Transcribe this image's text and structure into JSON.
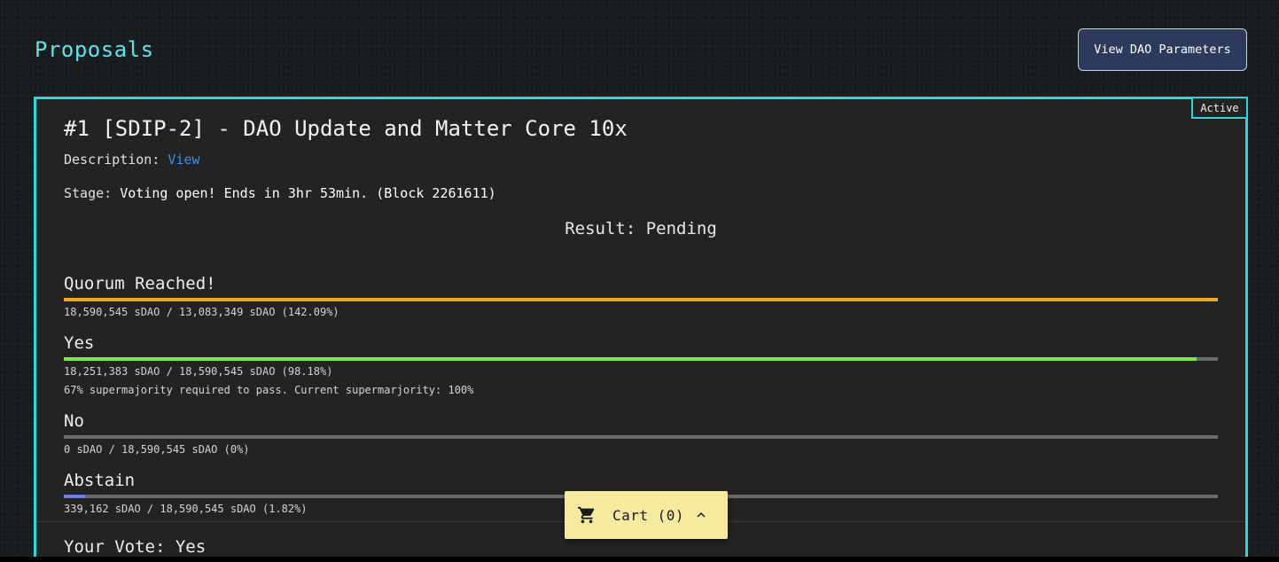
{
  "page": {
    "title": "Proposals"
  },
  "header": {
    "params_button": "View DAO Parameters"
  },
  "proposal": {
    "status": "Active",
    "title": "#1 [SDIP-2] - DAO Update and Matter Core 10x",
    "description_label": "Description:",
    "description_link": "View",
    "stage_label": "Stage:",
    "stage_value": "Voting open! Ends in 3hr 53min. (Block 2261611)",
    "result": "Result: Pending",
    "metrics": [
      {
        "label": "Quorum Reached!",
        "fill_fraction": 1.0,
        "fill_color": "#f5a623",
        "detail": "18,590,545 sDAO / 13,083,349 sDAO (142.09%)"
      },
      {
        "label": "Yes",
        "fill_fraction": 0.9818,
        "fill_color": "#7ee84a",
        "detail": "18,251,383 sDAO / 18,590,545 sDAO (98.18%)",
        "note": "67% supermajority required to pass. Current supermarjority: 100%"
      },
      {
        "label": "No",
        "fill_fraction": 0,
        "fill_color": "#7ee84a",
        "detail": "0 sDAO / 18,590,545 sDAO (0%)"
      },
      {
        "label": "Abstain",
        "fill_fraction": 0.0182,
        "fill_color": "#6f7fe8",
        "detail": "339,162 sDAO / 18,590,545 sDAO (1.82%)"
      }
    ],
    "your_vote": "Your Vote: Yes"
  },
  "cart": {
    "label": "Cart (0)",
    "icon": "cart-icon",
    "toggle_icon": "chevron-up-icon"
  }
}
